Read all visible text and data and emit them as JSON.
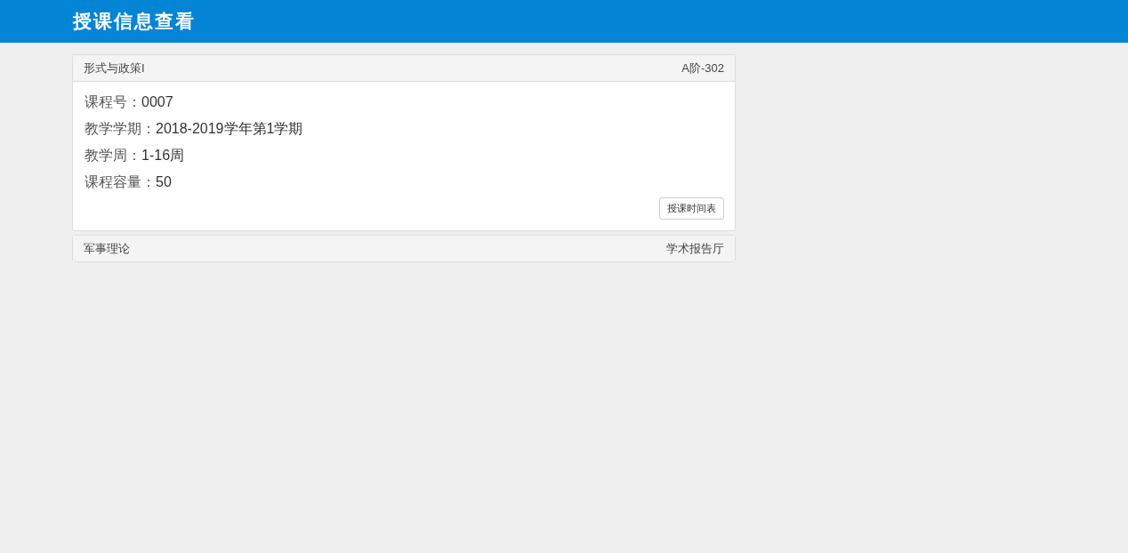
{
  "header": {
    "title": "授课信息查看"
  },
  "courses": [
    {
      "name": "形式与政策I",
      "room": "A阶-302",
      "expanded": true,
      "fields": [
        {
          "label": "课程号：",
          "value": "0007"
        },
        {
          "label": "教学学期：",
          "value": "2018-2019学年第1学期"
        },
        {
          "label": "教学周：",
          "value": "1-16周"
        },
        {
          "label": "课程容量：",
          "value": "50"
        }
      ],
      "button": "授课时间表"
    },
    {
      "name": "军事理论",
      "room": "学术报告厅",
      "expanded": false
    }
  ]
}
